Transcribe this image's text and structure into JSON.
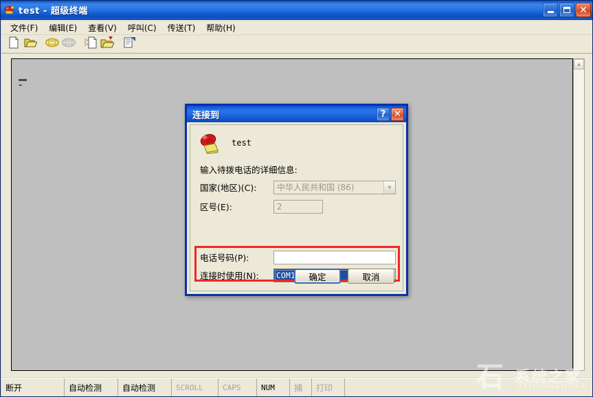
{
  "window": {
    "title": "test - 超级终端",
    "icon": "modem-phone-icon",
    "minimize_label": "最小化",
    "maximize_label": "最大化",
    "close_label": "关闭"
  },
  "menubar": {
    "items": [
      {
        "label": "文件(F)"
      },
      {
        "label": "编辑(E)"
      },
      {
        "label": "查看(V)"
      },
      {
        "label": "呼叫(C)"
      },
      {
        "label": "传送(T)"
      },
      {
        "label": "帮助(H)"
      }
    ]
  },
  "toolbar": {
    "buttons": [
      {
        "icon": "new-document-icon"
      },
      {
        "icon": "open-folder-icon"
      },
      {
        "icon": "call-phone-icon"
      },
      {
        "icon": "hangup-phone-icon"
      },
      {
        "icon": "send-file-icon"
      },
      {
        "icon": "receive-file-icon"
      },
      {
        "icon": "properties-icon"
      }
    ]
  },
  "terminal": {
    "content": "-",
    "scroll_up_icon": "chevron-up-icon"
  },
  "statusbar": {
    "cells": [
      {
        "label": "断开",
        "dim": false,
        "mono": false
      },
      {
        "label": "自动检测",
        "dim": false,
        "mono": false
      },
      {
        "label": "自动检测",
        "dim": false,
        "mono": false
      },
      {
        "label": "SCROLL",
        "dim": true,
        "mono": true
      },
      {
        "label": "CAPS",
        "dim": true,
        "mono": true
      },
      {
        "label": "NUM",
        "dim": false,
        "mono": true
      },
      {
        "label": "捕",
        "dim": true,
        "mono": false
      },
      {
        "label": "打印",
        "dim": true,
        "mono": false
      },
      {
        "label": "",
        "dim": false,
        "mono": false
      }
    ]
  },
  "watermark": {
    "logo": "石",
    "chinese": "系统之家",
    "english": "XITONGZHIJIA"
  },
  "dialog": {
    "title": "连接到",
    "help_label": "?",
    "close_label": "✕",
    "connection_icon": "red-telephone-icon",
    "connection_name": "test",
    "prompt": "输入待拨电话的详细信息:",
    "fields": {
      "country": {
        "label": "国家(地区)(C):",
        "value": "中华人民共和国  (86)",
        "arrow_icon": "chevron-down-icon"
      },
      "area_code": {
        "label": "区号(E):",
        "value": "2"
      },
      "phone_number": {
        "label": "电话号码(P):",
        "value": "",
        "placeholder": ""
      },
      "connect_using": {
        "label": "连接时使用(N):",
        "value": "COM1",
        "arrow_icon": "chevron-down-icon"
      }
    },
    "buttons": {
      "ok": "确定",
      "cancel": "取消"
    }
  }
}
